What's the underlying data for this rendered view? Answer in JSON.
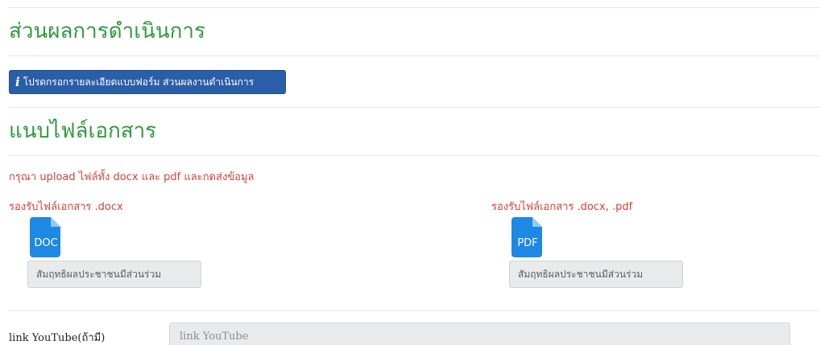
{
  "results_section": {
    "title": "ส่วนผลการดำเนินการ",
    "info_button_label": "โปรดกรอกรายละเอียดแบบฟอร์ม ส่วนผลงานดำเนินการ"
  },
  "attachments_section": {
    "title": "แนบไฟล์เอกสาร",
    "notice": "กรุณา upload ไฟล์ทั้ง docx และ pdf และกดส่งข้อมูล",
    "uploads": [
      {
        "accept_text": "รองรับไฟล์เอกสาร .docx",
        "icon": "doc-file-icon",
        "icon_label": "DOC",
        "button_label": "สัมฤทธิผลประชาชนมีส่วนร่วม"
      },
      {
        "accept_text": "รองรับไฟล์เอกสาร .docx, .pdf",
        "icon": "pdf-file-icon",
        "icon_label": "PDF",
        "button_label": "สัมฤทธิผลประชาชนมีส่วนร่วม"
      }
    ]
  },
  "youtube": {
    "label": "link YouTube(ถ้ามี)",
    "placeholder": "link YouTube",
    "value": ""
  },
  "colors": {
    "section_title": "#2e9a3c",
    "notice_text": "#d9413a",
    "info_button_bg": "#2b5ea8",
    "file_icon_blue": "#1e88e5"
  }
}
